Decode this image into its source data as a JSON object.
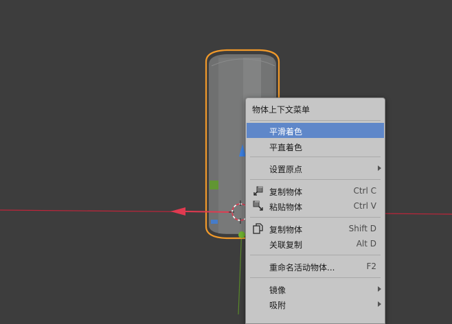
{
  "menu": {
    "title": "物体上下文菜单",
    "items": [
      {
        "label": "平滑着色"
      },
      {
        "label": "平直着色"
      },
      {
        "label": "设置原点"
      },
      {
        "label": "复制物体",
        "shortcut": "Ctrl C"
      },
      {
        "label": "粘贴物体",
        "shortcut": "Ctrl V"
      },
      {
        "label": "复制物体",
        "shortcut": "Shift D"
      },
      {
        "label": "关联复制",
        "shortcut": "Alt D"
      },
      {
        "label": "重命名活动物体...",
        "shortcut": "F2"
      },
      {
        "label": "镜像"
      },
      {
        "label": "吸附"
      }
    ],
    "highlight_color": "#5f87c9"
  },
  "viewport": {
    "background_color": "#3d3d3d",
    "x_axis_color": "#c2243a",
    "y_axis_color": "#5a8a2a",
    "selection_outline_color": "#f29a2a"
  }
}
